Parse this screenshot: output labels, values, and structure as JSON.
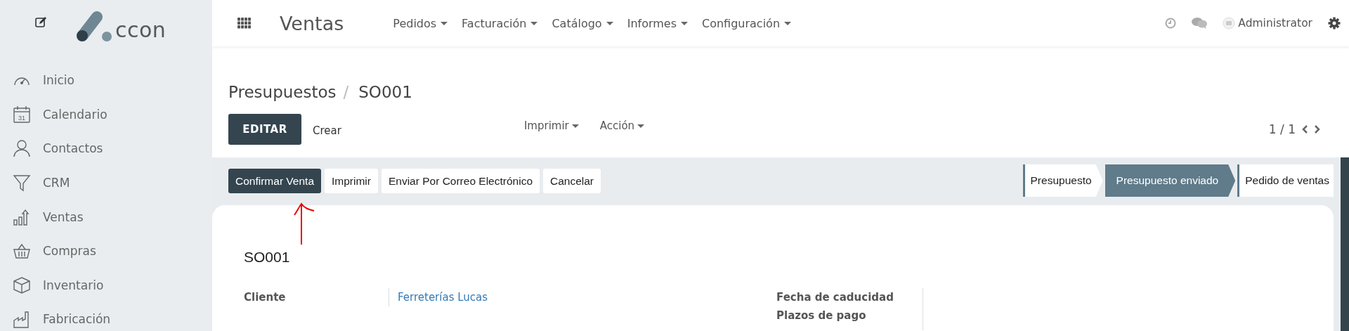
{
  "sidebar": {
    "logo_text": "ccon",
    "items": [
      {
        "label": "Inicio",
        "kind": "gauge"
      },
      {
        "label": "Calendario",
        "kind": "calendar",
        "icon_text": "31"
      },
      {
        "label": "Contactos",
        "kind": "person"
      },
      {
        "label": "CRM",
        "kind": "funnel"
      },
      {
        "label": "Ventas",
        "kind": "chart"
      },
      {
        "label": "Compras",
        "kind": "basket"
      },
      {
        "label": "Inventario",
        "kind": "box"
      },
      {
        "label": "Fabricación",
        "kind": "factory"
      }
    ]
  },
  "topbar": {
    "app_title": "Ventas",
    "menus": [
      "Pedidos",
      "Facturación",
      "Catálogo",
      "Informes",
      "Configuración"
    ],
    "user": "Administrator"
  },
  "control_panel": {
    "breadcrumb": [
      "Presupuestos",
      "SO001"
    ],
    "breadcrumb_separator": "/",
    "primary_button": "EDITAR",
    "secondary_button": "Crear",
    "dropdowns": [
      "Imprimir",
      "Acción"
    ],
    "pager": "1 / 1"
  },
  "header_buttons": [
    {
      "label": "Confirmar Venta",
      "primary": true
    },
    {
      "label": "Imprimir",
      "primary": false
    },
    {
      "label": "Enviar Por Correo Electrónico",
      "primary": false
    },
    {
      "label": "Cancelar",
      "primary": false
    }
  ],
  "stages": [
    {
      "label": "Presupuesto",
      "selected": false
    },
    {
      "label": "Presupuesto enviado",
      "selected": true
    },
    {
      "label": "Pedido de ventas",
      "selected": false
    }
  ],
  "form": {
    "title": "SO001",
    "left_fields": [
      {
        "label": "Cliente",
        "value": "Ferreterías Lucas"
      }
    ],
    "right_fields": [
      {
        "label": "Fecha de caducidad"
      },
      {
        "label": "Plazos de pago"
      }
    ]
  }
}
